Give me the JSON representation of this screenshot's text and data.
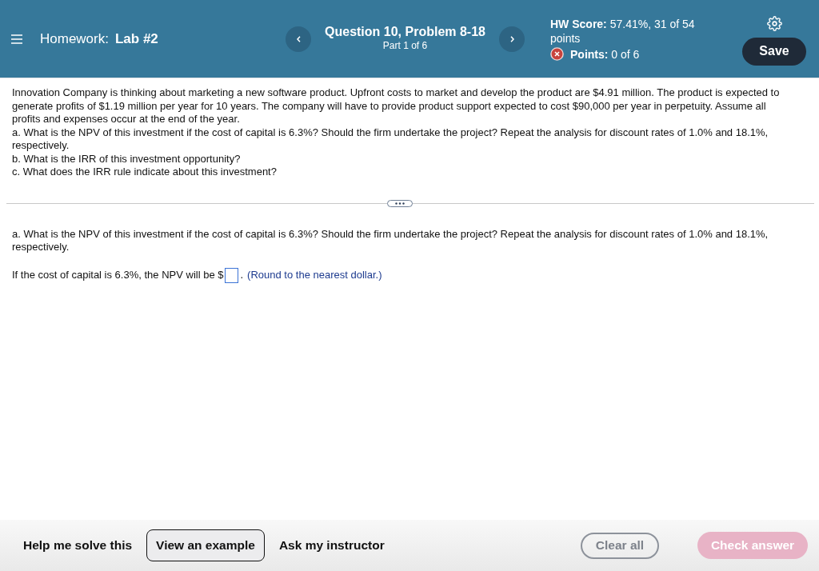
{
  "header": {
    "assignment_label": "Homework:",
    "assignment": "Lab #2",
    "question": "Question 10, Problem 8-18",
    "part": "Part 1 of 6",
    "score": "**HW Score:** 57.41%, 31 of 54 points",
    "points": {
      "text": "**Points:** 0 of 6",
      "correct": false
    },
    "save": "Save"
  },
  "problem": {
    "statement": "Innovation Company is thinking about marketing a new software product. Upfront costs to market and develop the product are $4.91 million. The product is expected to generate profits of $1.19 million per year for 10 years. The company will have to provide product support expected to cost $90,000 per year in perpetuity. Assume all profits and expenses occur at the end of the year.",
    "parts": [
      "a. What is the NPV of this investment if the cost of capital is 6.3%? Should the firm undertake the project? Repeat the analysis for discount rates of 1.0% and 18.1%, respectively.",
      "b. What is the IRR of this investment opportunity?",
      "c. What does the IRR rule indicate about this investment?"
    ]
  },
  "question": {
    "prompt": "a. What is the NPV of this investment if the cost of capital is 6.3%? Should the firm undertake the project? Repeat the analysis for discount rates of 1.0% and 18.1%, respectively.",
    "answer": {
      "prefix": "If the cost of capital is 6.3%, the NPV will be $",
      "suffix": ".",
      "hint": "(Round to the nearest dollar.)"
    }
  },
  "footer": {
    "help": [
      {
        "label": "Help me solve this",
        "kind": "plain"
      },
      {
        "label": "View an example",
        "kind": "outlined"
      },
      {
        "label": "Ask my instructor",
        "kind": "plain"
      }
    ],
    "actions": [
      {
        "label": "Clear all",
        "kind": "outline",
        "disabled": false
      },
      {
        "label": "Check answer",
        "kind": "primary",
        "disabled": true
      }
    ]
  }
}
